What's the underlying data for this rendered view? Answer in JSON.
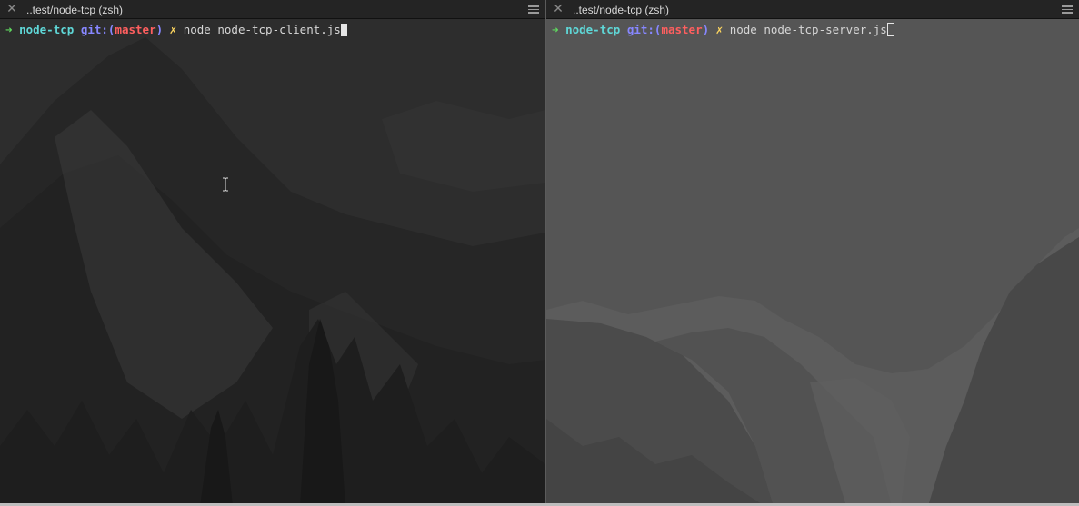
{
  "panes": [
    {
      "tab": {
        "title": "..test/node-tcp (zsh)"
      },
      "prompt": {
        "arrow": "➜",
        "dir": "node-tcp",
        "git_prefix": "git:(",
        "branch": "master",
        "git_suffix": ")",
        "dirty": "✗",
        "command": "node node-tcp-client.js"
      }
    },
    {
      "tab": {
        "title": "..test/node-tcp (zsh)"
      },
      "prompt": {
        "arrow": "➜",
        "dir": "node-tcp",
        "git_prefix": "git:(",
        "branch": "master",
        "git_suffix": ")",
        "dirty": "✗",
        "command": "node node-tcp-server.js"
      }
    }
  ],
  "icons": {
    "close": "close-icon",
    "menu": "hamburger-menu-icon",
    "text_cursor": "text-cursor-icon"
  },
  "colors": {
    "prompt_arrow": "#5fd75f",
    "directory": "#5fd7d7",
    "git_label": "#8787ff",
    "branch": "#ff5f5f",
    "dirty_marker": "#ffd75f"
  }
}
